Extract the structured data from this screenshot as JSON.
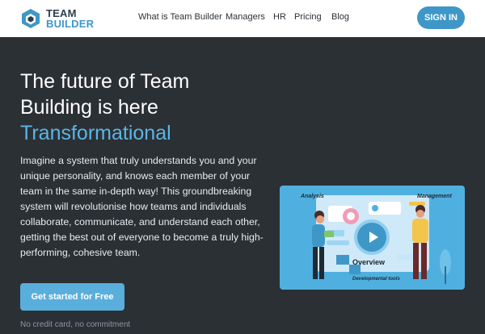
{
  "brand": {
    "line1": "TEAM",
    "line2": "BUILDER"
  },
  "nav": {
    "links": [
      "What is Team Builder",
      "Managers",
      "HR",
      "Pricing",
      "Blog"
    ],
    "signin": "SIGN IN"
  },
  "hero": {
    "title_line1": "The future of Team",
    "title_line2": "Building is here",
    "title_accent": "Transformational",
    "body": "Imagine a system that truly understands you and your unique personality, and knows each member of your team in the same in-depth way! This groundbreaking system will revolutionise how teams and individuals collaborate, communicate, and understand each other, getting the best out of everyone to become a truly high-performing, cohesive team.",
    "cta": "Get started for Free",
    "note": "No credit card, no commitment"
  },
  "illustration": {
    "label_analysis": "Analysis",
    "label_management": "Management",
    "label_overview": "Overview",
    "label_tools": "Developmental tools"
  },
  "colors": {
    "accent": "#3f97c8",
    "background": "#2b3035",
    "highlight": "#5ab6e6"
  }
}
